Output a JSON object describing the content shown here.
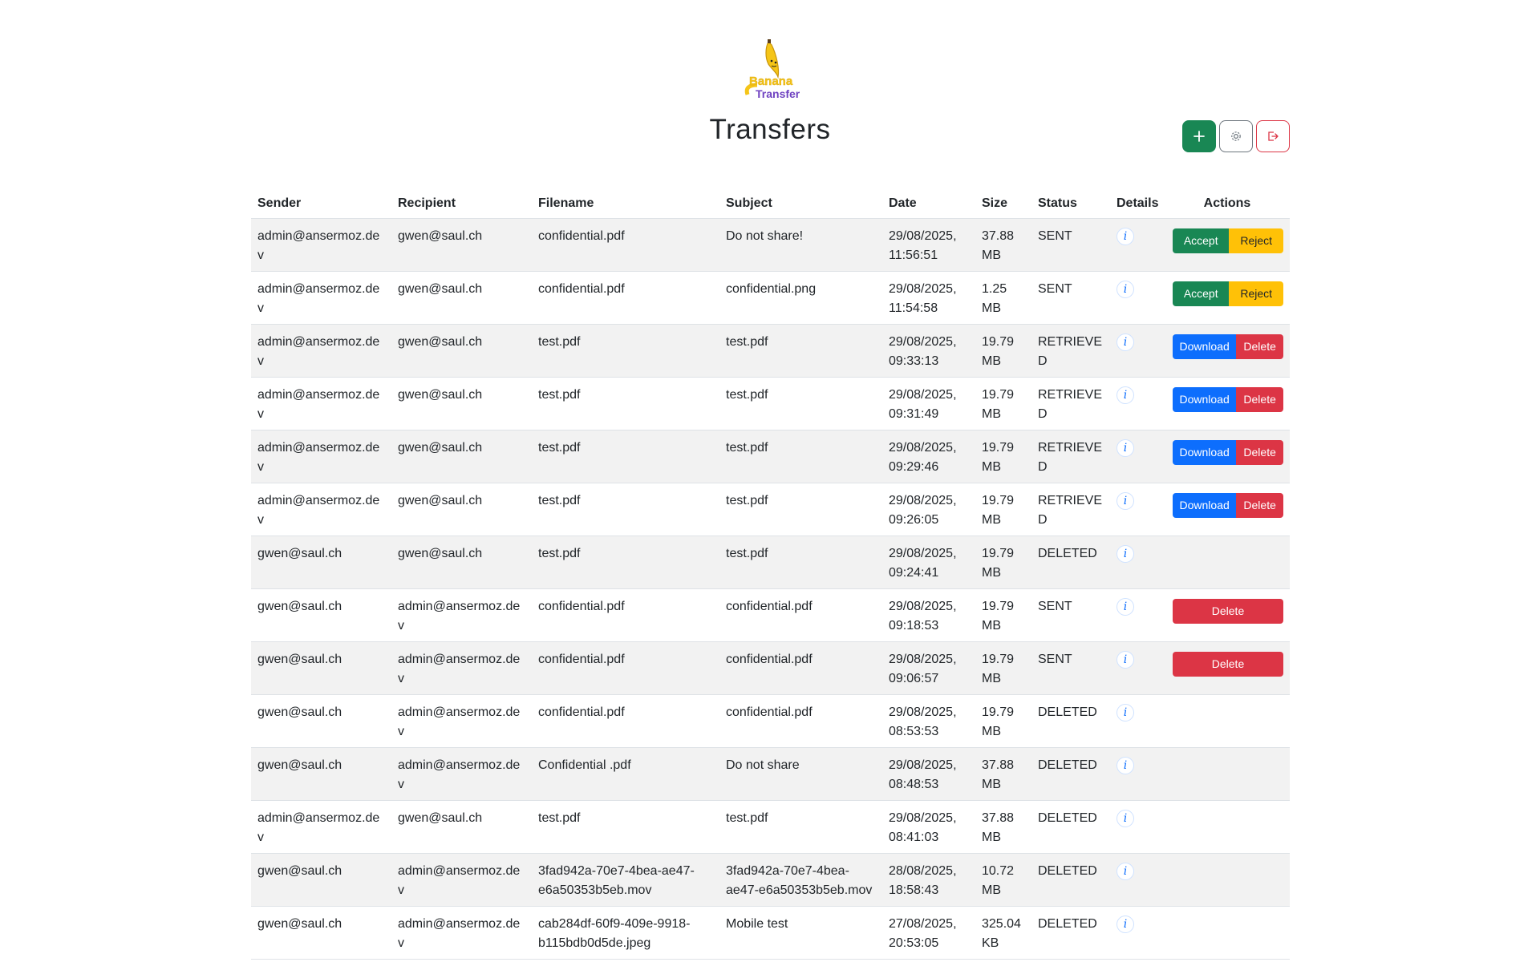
{
  "logo": {
    "line1": "Banana",
    "line2": "Transfer"
  },
  "page": {
    "title": "Transfers"
  },
  "toolbar": {
    "add_icon": "plus-icon",
    "settings_icon": "gear-icon",
    "logout_icon": "logout-icon"
  },
  "table": {
    "headers": {
      "sender": "Sender",
      "recipient": "Recipient",
      "filename": "Filename",
      "subject": "Subject",
      "date": "Date",
      "size": "Size",
      "status": "Status",
      "details": "Details",
      "actions": "Actions"
    },
    "details_label": "i",
    "action_labels": {
      "accept": "Accept",
      "reject": "Reject",
      "download": "Download",
      "delete": "Delete"
    },
    "rows": [
      {
        "sender": "admin@ansermoz.dev",
        "recipient": "gwen@saul.ch",
        "filename": "confidential.pdf",
        "subject": "Do not share!",
        "date": "29/08/2025, 11:56:51",
        "size": "37.88 MB",
        "status": "SENT",
        "actions": "accept-reject"
      },
      {
        "sender": "admin@ansermoz.dev",
        "recipient": "gwen@saul.ch",
        "filename": "confidential.pdf",
        "subject": "confidential.png",
        "date": "29/08/2025, 11:54:58",
        "size": "1.25 MB",
        "status": "SENT",
        "actions": "accept-reject"
      },
      {
        "sender": "admin@ansermoz.dev",
        "recipient": "gwen@saul.ch",
        "filename": "test.pdf",
        "subject": "test.pdf",
        "date": "29/08/2025, 09:33:13",
        "size": "19.79 MB",
        "status": "RETRIEVED",
        "actions": "download-delete"
      },
      {
        "sender": "admin@ansermoz.dev",
        "recipient": "gwen@saul.ch",
        "filename": "test.pdf",
        "subject": "test.pdf",
        "date": "29/08/2025, 09:31:49",
        "size": "19.79 MB",
        "status": "RETRIEVED",
        "actions": "download-delete"
      },
      {
        "sender": "admin@ansermoz.dev",
        "recipient": "gwen@saul.ch",
        "filename": "test.pdf",
        "subject": "test.pdf",
        "date": "29/08/2025, 09:29:46",
        "size": "19.79 MB",
        "status": "RETRIEVED",
        "actions": "download-delete"
      },
      {
        "sender": "admin@ansermoz.dev",
        "recipient": "gwen@saul.ch",
        "filename": "test.pdf",
        "subject": "test.pdf",
        "date": "29/08/2025, 09:26:05",
        "size": "19.79 MB",
        "status": "RETRIEVED",
        "actions": "download-delete"
      },
      {
        "sender": "gwen@saul.ch",
        "recipient": "gwen@saul.ch",
        "filename": "test.pdf",
        "subject": "test.pdf",
        "date": "29/08/2025, 09:24:41",
        "size": "19.79 MB",
        "status": "DELETED",
        "actions": "none"
      },
      {
        "sender": "gwen@saul.ch",
        "recipient": "admin@ansermoz.dev",
        "filename": "confidential.pdf",
        "subject": "confidential.pdf",
        "date": "29/08/2025, 09:18:53",
        "size": "19.79 MB",
        "status": "SENT",
        "actions": "delete"
      },
      {
        "sender": "gwen@saul.ch",
        "recipient": "admin@ansermoz.dev",
        "filename": "confidential.pdf",
        "subject": "confidential.pdf",
        "date": "29/08/2025, 09:06:57",
        "size": "19.79 MB",
        "status": "SENT",
        "actions": "delete"
      },
      {
        "sender": "gwen@saul.ch",
        "recipient": "admin@ansermoz.dev",
        "filename": "confidential.pdf",
        "subject": "confidential.pdf",
        "date": "29/08/2025, 08:53:53",
        "size": "19.79 MB",
        "status": "DELETED",
        "actions": "none"
      },
      {
        "sender": "gwen@saul.ch",
        "recipient": "admin@ansermoz.dev",
        "filename": "Confidential .pdf",
        "subject": "Do not share",
        "date": "29/08/2025, 08:48:53",
        "size": "37.88 MB",
        "status": "DELETED",
        "actions": "none"
      },
      {
        "sender": "admin@ansermoz.dev",
        "recipient": "gwen@saul.ch",
        "filename": "test.pdf",
        "subject": "test.pdf",
        "date": "29/08/2025, 08:41:03",
        "size": "37.88 MB",
        "status": "DELETED",
        "actions": "none"
      },
      {
        "sender": "gwen@saul.ch",
        "recipient": "admin@ansermoz.dev",
        "filename": "3fad942a-70e7-4bea-ae47-e6a50353b5eb.mov",
        "subject": "3fad942a-70e7-4bea-ae47-e6a50353b5eb.mov",
        "date": "28/08/2025, 18:58:43",
        "size": "10.72 MB",
        "status": "DELETED",
        "actions": "none"
      },
      {
        "sender": "gwen@saul.ch",
        "recipient": "admin@ansermoz.dev",
        "filename": "cab284df-60f9-409e-9918-b115bdb0d5de.jpeg",
        "subject": "Mobile test",
        "date": "27/08/2025, 20:53:05",
        "size": "325.04 KB",
        "status": "DELETED",
        "actions": "none"
      }
    ]
  },
  "colors": {
    "accept": "#198754",
    "reject": "#ffc107",
    "download": "#0d6efd",
    "delete": "#dc3545",
    "row_stripe": "#f2f2f2"
  }
}
